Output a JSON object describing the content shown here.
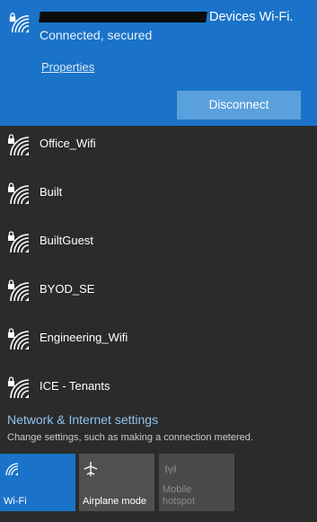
{
  "connected": {
    "ssid_visible_suffix": "Devices Wi-Fi.",
    "status": "Connected, secured",
    "properties_label": "Properties",
    "disconnect_label": "Disconnect",
    "icon": "wifi-secured-icon"
  },
  "networks": [
    {
      "name": "Office_Wifi",
      "icon": "wifi-secured-icon"
    },
    {
      "name": "Built",
      "icon": "wifi-secured-icon"
    },
    {
      "name": "BuiltGuest",
      "icon": "wifi-secured-icon"
    },
    {
      "name": "BYOD_SE",
      "icon": "wifi-secured-icon"
    },
    {
      "name": "Engineering_Wifi",
      "icon": "wifi-secured-icon"
    },
    {
      "name": "ICE - Tenants",
      "icon": "wifi-secured-icon"
    }
  ],
  "settings": {
    "title": "Network & Internet settings",
    "description": "Change settings, such as making a connection metered."
  },
  "quick_actions": [
    {
      "label": "Wi-Fi",
      "state": "on",
      "icon": "wifi-icon"
    },
    {
      "label": "Airplane mode",
      "state": "off",
      "icon": "airplane-icon"
    },
    {
      "label_line1": "Mobile",
      "label_line2": "hotspot",
      "state": "disabled",
      "icon": "hotspot-icon"
    }
  ],
  "colors": {
    "accent": "#1a73c8",
    "background": "#2b2b2b",
    "link": "#8fc3f0"
  }
}
